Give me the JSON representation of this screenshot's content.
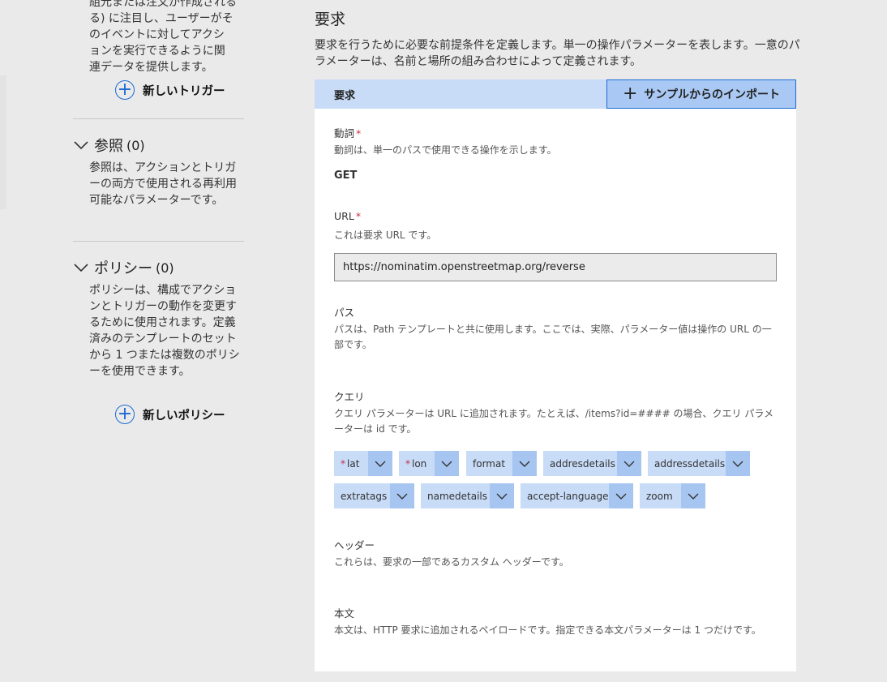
{
  "left": {
    "trigger_desc_lines": [
      "組元または注文が作成される",
      "る) に注目し、ユーザーがそ",
      "のイベントに対してアクシ",
      "ョンを実行できるように関",
      "連データを提供します。"
    ],
    "new_trigger": "新しいトリガー",
    "references": {
      "title": "参照",
      "count": "(0)",
      "desc": "参照は、アクションとトリガーの両方で使用される再利用可能なパラメーターです。"
    },
    "policies": {
      "title": "ポリシー",
      "count": "(0)",
      "desc": "ポリシーは、構成でアクションとトリガーの動作を変更するために使用されます。定義済みのテンプレートのセットから 1 つまたは複数のポリシーを使用できます。"
    },
    "new_policy": "新しいポリシー"
  },
  "main": {
    "title": "要求",
    "desc": "要求を行うために必要な前提条件を定義します。単一の操作パラメーターを表します。一意のパラメーターは、名前と場所の組み合わせによって定義されます。",
    "card_title": "要求",
    "import_button": "サンプルからのインポート",
    "verb": {
      "label": "動詞",
      "required": "*",
      "help": "動詞は、単一のパスで使用できる操作を示します。",
      "value": "GET"
    },
    "url": {
      "label": "URL",
      "required": "*",
      "help": "これは要求 URL です。",
      "value": "https://nominatim.openstreetmap.org/reverse"
    },
    "path": {
      "label": "パス",
      "help": "パスは、Path テンプレートと共に使用します。ここでは、実際、パラメーター値は操作の URL の一部です。"
    },
    "query": {
      "label": "クエリ",
      "help": "クエリ パラメーターは URL に追加されます。たとえば、/items?id=#### の場合、クエリ パラメーターは id です。",
      "params": [
        {
          "name": "lat",
          "required": "*"
        },
        {
          "name": "lon",
          "required": "*"
        },
        {
          "name": "format",
          "required": ""
        },
        {
          "name": "addresdetails",
          "required": ""
        },
        {
          "name": "addressdetails",
          "required": ""
        },
        {
          "name": "extratags",
          "required": ""
        },
        {
          "name": "namedetails",
          "required": ""
        },
        {
          "name": "accept-language",
          "required": ""
        },
        {
          "name": "zoom",
          "required": ""
        }
      ]
    },
    "headers": {
      "label": "ヘッダー",
      "help": "これらは、要求の一部であるカスタム ヘッダーです。"
    },
    "body": {
      "label": "本文",
      "help": "本文は、HTTP 要求に追加されるペイロードです。指定できる本文パラメーターは 1 つだけです。"
    }
  },
  "colors": {
    "accent": "#1b6ad3",
    "chip": "#c8dbf7",
    "chip_dropdown": "#a6c6f1",
    "required": "#c4314b"
  }
}
